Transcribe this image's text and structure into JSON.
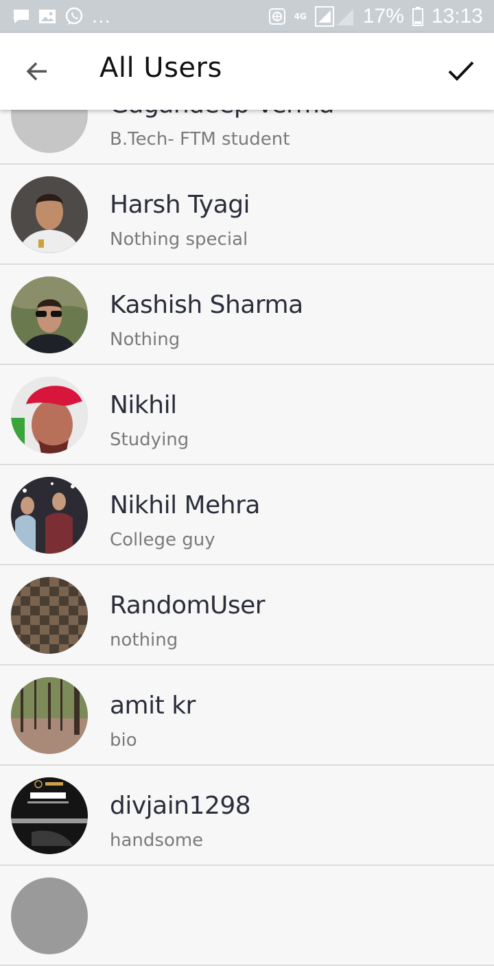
{
  "status_bar": {
    "battery": "17%",
    "time": "13:13",
    "network": "4G",
    "overflow": "...",
    "icons": [
      "message-icon",
      "gallery-icon",
      "whatsapp-icon",
      "vpn-icon",
      "signal-icon",
      "battery-icon"
    ]
  },
  "appbar": {
    "title": "All Users",
    "back_icon": "arrow-back-icon",
    "confirm_icon": "check-icon"
  },
  "users": [
    {
      "name": "Gagandeep Verma",
      "bio": "B.Tech- FTM student",
      "avatar": "placeholder"
    },
    {
      "name": "Harsh Tyagi",
      "bio": "Nothing special",
      "avatar": "photo"
    },
    {
      "name": "Kashish Sharma",
      "bio": "Nothing",
      "avatar": "photo"
    },
    {
      "name": "Nikhil",
      "bio": "Studying",
      "avatar": "photo"
    },
    {
      "name": "Nikhil Mehra",
      "bio": "College guy",
      "avatar": "photo"
    },
    {
      "name": "RandomUser",
      "bio": "nothing",
      "avatar": "photo"
    },
    {
      "name": "amit kr",
      "bio": "bio",
      "avatar": "photo"
    },
    {
      "name": "divjain1298",
      "bio": "handsome",
      "avatar": "photo"
    },
    {
      "name": "",
      "bio": "",
      "avatar": "photo"
    }
  ]
}
